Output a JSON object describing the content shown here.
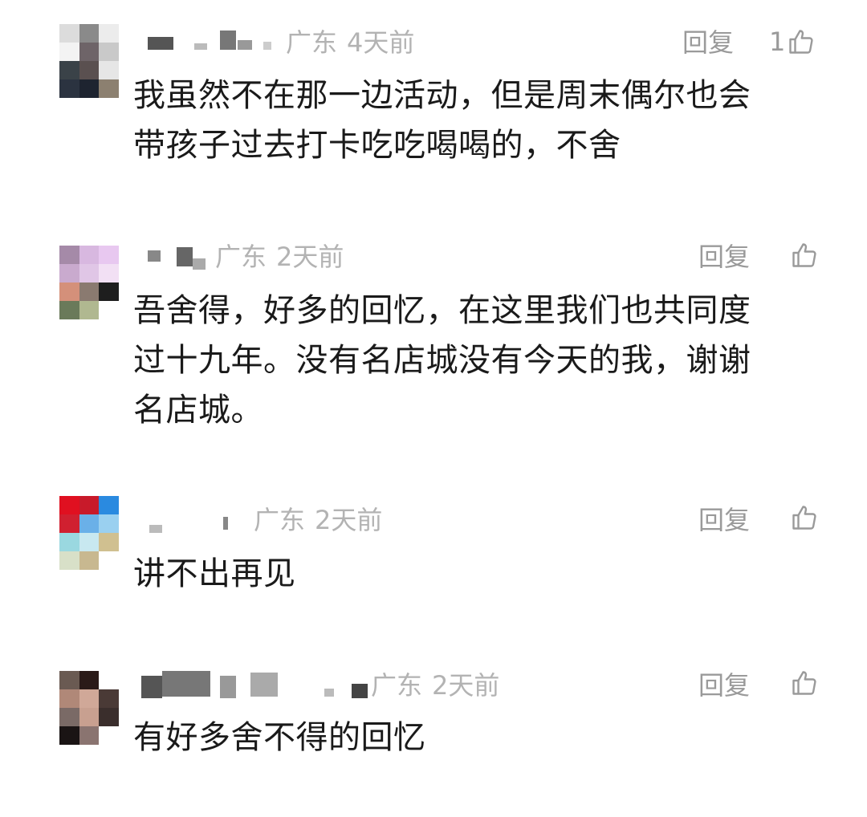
{
  "comments": [
    {
      "region": "广东",
      "time": "4天前",
      "reply_label": "回复",
      "like_count": "1",
      "text": "我虽然不在那一边活动，但是周末偶尔也会\n带孩子过去打卡吃吃喝喝的，不舍"
    },
    {
      "region": "广东",
      "time": "2天前",
      "reply_label": "回复",
      "like_count": "",
      "text": "吾舍得，好多的回忆，在这里我们也共同度\n过十九年。没有名店城没有今天的我，谢谢\n名店城。"
    },
    {
      "region": "广东",
      "time": "2天前",
      "reply_label": "回复",
      "like_count": "",
      "text": "讲不出再见"
    },
    {
      "region": "广东",
      "time": "2天前",
      "reply_label": "回复",
      "like_count": "",
      "text": "有好多舍不得的回忆"
    }
  ],
  "icons": {
    "like": "thumbs-up-icon",
    "avatar": "avatar"
  },
  "colors": {
    "meta": "#b3b3b3",
    "action": "#9a9a9a",
    "text": "#1a1a1a"
  }
}
